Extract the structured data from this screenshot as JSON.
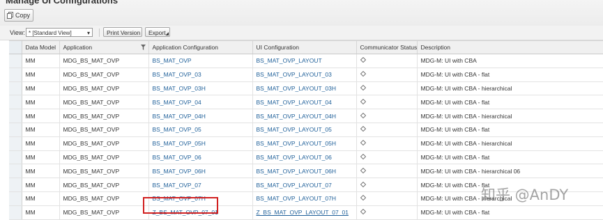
{
  "header": {
    "title": "Manage UI Configurations",
    "copy_label": "Copy"
  },
  "toolbar": {
    "view_label": "View:",
    "view_value": "* [Standard View]",
    "print_label": "Print Version",
    "export_label": "Export"
  },
  "table": {
    "columns": [
      "Data Model",
      "Application",
      "Application Configuration",
      "UI Configuration",
      "Communicator Status",
      "Description"
    ],
    "rows": [
      {
        "data_model": "MM",
        "application": "MDG_BS_MAT_OVP",
        "app_config": "BS_MAT_OVP",
        "ui_config": "BS_MAT_OVP_LAYOUT",
        "description": "MDG-M: UI with CBA"
      },
      {
        "data_model": "MM",
        "application": "MDG_BS_MAT_OVP",
        "app_config": "BS_MAT_OVP_03",
        "ui_config": "BS_MAT_OVP_LAYOUT_03",
        "description": "MDG-M: UI with CBA - flat"
      },
      {
        "data_model": "MM",
        "application": "MDG_BS_MAT_OVP",
        "app_config": "BS_MAT_OVP_03H",
        "ui_config": "BS_MAT_OVP_LAYOUT_03H",
        "description": "MDG-M: UI with CBA - hierarchical"
      },
      {
        "data_model": "MM",
        "application": "MDG_BS_MAT_OVP",
        "app_config": "BS_MAT_OVP_04",
        "ui_config": "BS_MAT_OVP_LAYOUT_04",
        "description": "MDG-M: UI with CBA - flat"
      },
      {
        "data_model": "MM",
        "application": "MDG_BS_MAT_OVP",
        "app_config": "BS_MAT_OVP_04H",
        "ui_config": "BS_MAT_OVP_LAYOUT_04H",
        "description": "MDG-M: UI with CBA - hierarchical"
      },
      {
        "data_model": "MM",
        "application": "MDG_BS_MAT_OVP",
        "app_config": "BS_MAT_OVP_05",
        "ui_config": "BS_MAT_OVP_LAYOUT_05",
        "description": "MDG-M: UI with CBA - flat"
      },
      {
        "data_model": "MM",
        "application": "MDG_BS_MAT_OVP",
        "app_config": "BS_MAT_OVP_05H",
        "ui_config": "BS_MAT_OVP_LAYOUT_05H",
        "description": "MDG-M: UI with CBA - hierarchical"
      },
      {
        "data_model": "MM",
        "application": "MDG_BS_MAT_OVP",
        "app_config": "BS_MAT_OVP_06",
        "ui_config": "BS_MAT_OVP_LAYOUT_06",
        "description": "MDG-M: UI with CBA - flat"
      },
      {
        "data_model": "MM",
        "application": "MDG_BS_MAT_OVP",
        "app_config": "BS_MAT_OVP_06H",
        "ui_config": "BS_MAT_OVP_LAYOUT_06H",
        "description": "MDG-M: UI with CBA - hierarchical 06"
      },
      {
        "data_model": "MM",
        "application": "MDG_BS_MAT_OVP",
        "app_config": "BS_MAT_OVP_07",
        "ui_config": "BS_MAT_OVP_LAYOUT_07",
        "description": "MDG-M: UI with CBA - flat"
      },
      {
        "data_model": "MM",
        "application": "MDG_BS_MAT_OVP",
        "app_config": "BS_MAT_OVP_07H",
        "ui_config": "BS_MAT_OVP_LAYOUT_07H",
        "description": "MDG-M: UI with CBA - hierarchical"
      },
      {
        "data_model": "MM",
        "application": "MDG_BS_MAT_OVP",
        "app_config": "Z_BS_MAT_OVP_07_01",
        "ui_config": "Z_BS_MAT_OVP_LAYOUT_07_01",
        "description": "MDG-M: UI with CBA - flat"
      }
    ]
  },
  "icons": {
    "copy": "copy-icon",
    "filter": "filter-icon",
    "status": "diamond-status-icon"
  },
  "colors": {
    "link": "#1e5f99",
    "highlight": "#d11f1f"
  },
  "watermark": "知乎 @AnDY"
}
